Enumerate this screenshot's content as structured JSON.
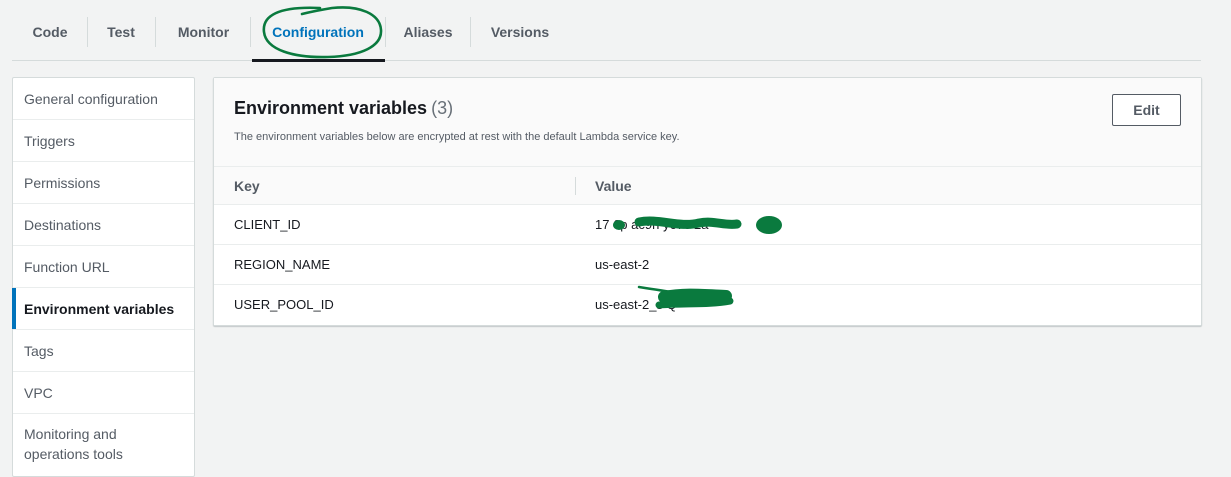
{
  "tabs": [
    {
      "label": "Code"
    },
    {
      "label": "Test"
    },
    {
      "label": "Monitor"
    },
    {
      "label": "Configuration",
      "active": true
    },
    {
      "label": "Aliases"
    },
    {
      "label": "Versions"
    }
  ],
  "sidebar": {
    "items": [
      {
        "label": "General configuration"
      },
      {
        "label": "Triggers"
      },
      {
        "label": "Permissions"
      },
      {
        "label": "Destinations"
      },
      {
        "label": "Function URL"
      },
      {
        "label": "Environment variables",
        "active": true
      },
      {
        "label": "Tags"
      },
      {
        "label": "VPC"
      },
      {
        "label": "Monitoring and operations tools"
      }
    ]
  },
  "panel": {
    "title": "Environment variables",
    "count": "(3)",
    "description": "The environment variables below are encrypted at rest with the default Lambda service key.",
    "edit_label": "Edit",
    "columns": {
      "key": "Key",
      "value": "Value"
    },
    "rows": [
      {
        "key": "CLIENT_ID",
        "value": "17  6p        ac9n       y67c      2a"
      },
      {
        "key": "REGION_NAME",
        "value": "us-east-2"
      },
      {
        "key": "USER_POOL_ID",
        "value": "us-east-2_s                  Q"
      }
    ]
  },
  "colors": {
    "accent": "#0073bb",
    "annotation_green": "#0a7a3e"
  }
}
